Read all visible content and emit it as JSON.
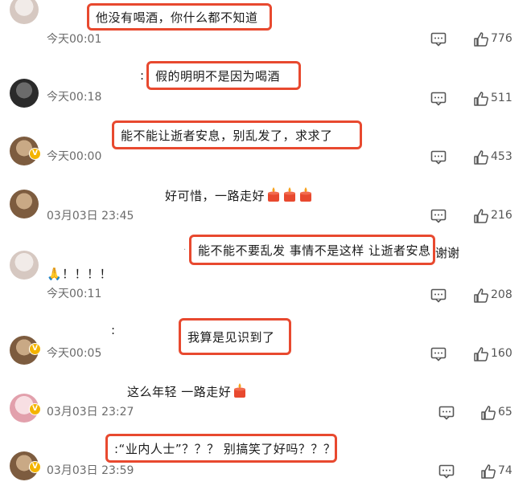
{
  "colors": {
    "highlight": "#e8492f",
    "text": "#1a1a1a",
    "time": "#6b6b6b",
    "icon": "#555555",
    "candle": "#e8492f"
  },
  "comments": [
    {
      "time": "今天00:01",
      "text": "他没有喝酒，你什么都不知道",
      "likes": "776"
    },
    {
      "prefix": ":",
      "time": "今天00:18",
      "text": "假的明明不是因为喝酒",
      "likes": "511"
    },
    {
      "time": "今天00:00",
      "text": "能不能让逝者安息，别乱发了，求求了",
      "likes": "453"
    },
    {
      "time": "03月03日 23:45",
      "text": "好可惜，一路走好",
      "likes": "216"
    },
    {
      "time": "今天00:11",
      "text": "能不能不要乱发 事情不是这样 让逝者安息",
      "tail": "谢谢",
      "line2": "🙏！！！！",
      "likes": "208"
    },
    {
      "prefix": ":",
      "time": "今天00:05",
      "text": "我算是见识到了",
      "likes": "160"
    },
    {
      "time": "03月03日 23:27",
      "text": "这么年轻 一路走好",
      "likes": "65"
    },
    {
      "time": "03月03日 23:59",
      "text": ":“业内人士”？？？ 别搞笑了好吗？？？",
      "likes": "74"
    }
  ]
}
